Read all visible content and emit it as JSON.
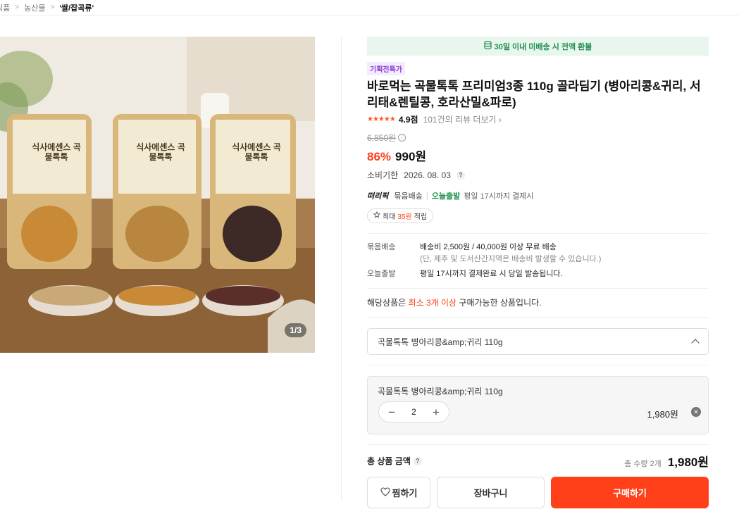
{
  "breadcrumb": {
    "items": [
      "식품",
      "농산물"
    ],
    "current": "'쌀/잡곡류'"
  },
  "gallery": {
    "counter": "1/3",
    "product_label_1": "식사에센스 곡물톡톡",
    "product_label_2": "식사에센스 곡물톡톡",
    "product_label_3": "식사에센스 곡물톡톡"
  },
  "banner": {
    "text": "30일 이내 미배송 시 전액 환불"
  },
  "badge": "기획전특가",
  "title": "바로먹는 곡물톡톡 프리미엄3종 110g 골라딤기 (병아리콩&귀리, 서리태&렌틸콩, 호라산밀&파로)",
  "rating": {
    "stars": "★★★★★",
    "score": "4.9점",
    "reviews": "101건의 리뷰 더보기 ›"
  },
  "price": {
    "original": "6,850원",
    "discount": "86%",
    "sale": "990원"
  },
  "expiry": {
    "label": "소비기한",
    "date": "2026. 08. 03"
  },
  "shipping_badges": {
    "brand": "떠리픽",
    "bundle": "묶음배송",
    "today": "오늘출발",
    "today_desc": "평일 17시까지 결제시"
  },
  "points": {
    "prefix": "최대 ",
    "amount": "35원",
    "suffix": " 적립"
  },
  "shipping": {
    "bundle_label": "묶음배송",
    "bundle_value": "배송비 2,500원 / 40,000원 이상 무료 배송",
    "bundle_sub": "(단, 제주 및 도서산간지역은 배송비 발생할 수 있습니다.)",
    "today_label": "오늘출발",
    "today_value": "평일 17시까지 결제완료 시 당일 발송됩니다."
  },
  "min_notice": {
    "prefix": "해당상품은 ",
    "highlight": "최소 3개 이상",
    "suffix": " 구매가능한 상품입니다."
  },
  "option_select": {
    "value": "곡물톡톡 병아리콩&amp;귀리 110g"
  },
  "selected_option": {
    "name": "곡물톡톡 병아리콩&amp;귀리 110g",
    "qty": "2",
    "price": "1,980원",
    "minus": "−",
    "plus": "+"
  },
  "total": {
    "label": "총 상품 금액",
    "qty": "총 수량 2개",
    "price": "1,980원"
  },
  "actions": {
    "wish": "찜하기",
    "cart": "장바구니",
    "buy": "구매하기"
  },
  "colors": {
    "accent": "#ff4019",
    "green": "#1f8f4e",
    "badge_purple": "#8a3ed6"
  }
}
